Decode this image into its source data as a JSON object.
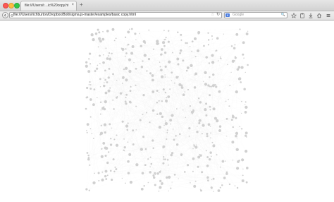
{
  "window": {
    "tab_title": "file:///Users/r…ic%20copy.html",
    "tab_close": "×",
    "new_tab": "+"
  },
  "navbar": {
    "url": "file:///Users/richburton/Dropbox/Bolt/sigma.js-master/examples/basic copy.html",
    "url_star": "☆",
    "reload": "↻",
    "search_engine_badge": "8",
    "search_placeholder": "Google",
    "search_go": "🔍"
  },
  "toolbar": {
    "icons": [
      "bookmark-star-icon",
      "clipboard-icon",
      "download-icon",
      "home-icon",
      "menu-icon"
    ]
  },
  "content": {
    "graph": {
      "node_color": "#d0d0d0",
      "edge_color": "#eeeeee"
    }
  },
  "colors": {
    "traffic_close": "#fc5753",
    "traffic_min": "#fdbc40",
    "traffic_max": "#33c748",
    "search_badge": "#4a7ce0"
  }
}
